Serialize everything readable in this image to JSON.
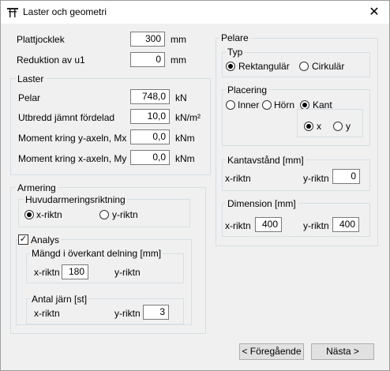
{
  "window": {
    "title": "Laster och geometri",
    "close_icon": "close-icon"
  },
  "top": {
    "platt_label": "Plattjocklek",
    "platt_value": "300",
    "platt_unit": "mm",
    "red_label": "Reduktion av u1",
    "red_value": "0",
    "red_unit": "mm"
  },
  "laster": {
    "title": "Laster",
    "rows": [
      {
        "label": "Pelar",
        "value": "748,0",
        "unit": "kN"
      },
      {
        "label": "Utbredd jämnt fördelad",
        "value": "10,0",
        "unit": "kN/m²"
      },
      {
        "label": "Moment kring y-axeln, Mx",
        "value": "0,0",
        "unit": "kNm"
      },
      {
        "label": "Moment kring x-axeln, My",
        "value": "0,0",
        "unit": "kNm"
      }
    ]
  },
  "armering": {
    "title": "Armering",
    "huvud_title": "Huvudarmeringsriktning",
    "x_label": "x-riktn",
    "y_label": "y-riktn",
    "selected": "x-riktn"
  },
  "analys": {
    "label": "Analys",
    "checked": true,
    "mangd_title": "Mängd i överkant delning [mm]",
    "mangd_x_label": "x-riktn",
    "mangd_x_value": "180",
    "mangd_y_label": "y-riktn",
    "antal_title": "Antal järn [st]",
    "antal_x_label": "x-riktn",
    "antal_y_label": "y-riktn",
    "antal_y_value": "3"
  },
  "pelare": {
    "title": "Pelare",
    "typ_title": "Typ",
    "typ_rekt": "Rektangulär",
    "typ_cirk": "Cirkulär",
    "typ_selected": "Rektangulär",
    "plac_title": "Placering",
    "plac_inner": "Inner",
    "plac_horn": "Hörn",
    "plac_kant": "Kant",
    "plac_selected": "Kant",
    "kant_x": "x",
    "kant_y": "y",
    "kant_selected": "x",
    "kantav_title": "Kantavstånd [mm]",
    "kantav_x_label": "x-riktn",
    "kantav_y_label": "y-riktn",
    "kantav_y_value": "0",
    "dim_title": "Dimension [mm]",
    "dim_x_label": "x-riktn",
    "dim_x_value": "400",
    "dim_y_label": "y-riktn",
    "dim_y_value": "400"
  },
  "buttons": {
    "prev": "< Föregående",
    "next": "Nästa >"
  }
}
